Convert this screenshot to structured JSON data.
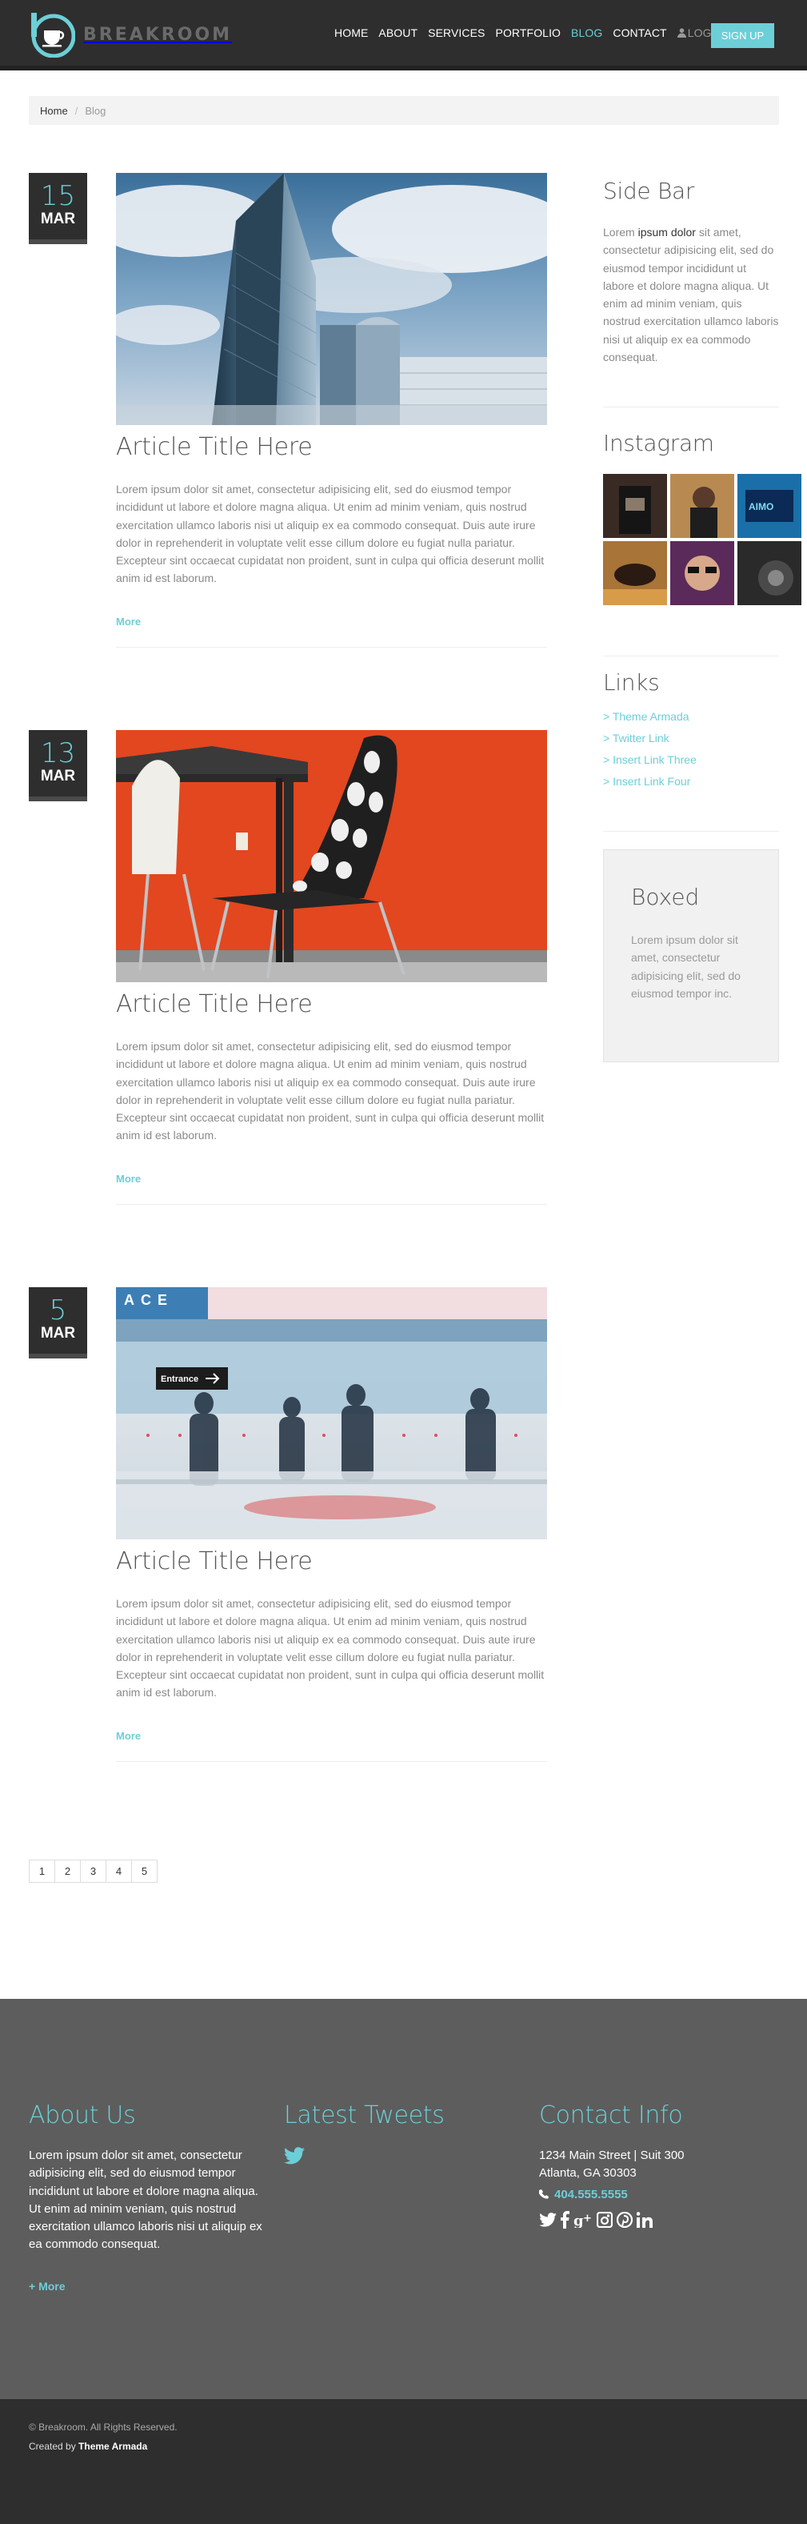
{
  "header": {
    "brand": "BREAKROOM",
    "nav": [
      {
        "label": "HOME",
        "active": false
      },
      {
        "label": "ABOUT",
        "active": false
      },
      {
        "label": "SERVICES",
        "active": false
      },
      {
        "label": "PORTFOLIO",
        "active": false
      },
      {
        "label": "BLOG",
        "active": true
      },
      {
        "label": "CONTACT",
        "active": false
      }
    ],
    "login_label": "LOGIN",
    "signup_label": "SIGN UP",
    "accent_color": "#6ccfd7"
  },
  "breadcrumb": {
    "home": "Home",
    "separator": "/",
    "current": "Blog"
  },
  "posts": [
    {
      "day": "15",
      "month": "MAR",
      "title": "Article Title Here",
      "body": "Lorem ipsum dolor sit amet, consectetur adipisicing elit, sed do eiusmod tempor incididunt ut labore et dolore magna aliqua. Ut enim ad minim veniam, quis nostrud exercitation ullamco laboris nisi ut aliquip ex ea commodo consequat. Duis aute irure dolor in reprehenderit in voluptate velit esse cillum dolore eu fugiat nulla pariatur. Excepteur sint occaecat cupidatat non proident, sunt in culpa qui officia deserunt mollit anim id est laborum.",
      "more": "More"
    },
    {
      "day": "13",
      "month": "MAR",
      "title": "Article Title Here",
      "body": "Lorem ipsum dolor sit amet, consectetur adipisicing elit, sed do eiusmod tempor incididunt ut labore et dolore magna aliqua. Ut enim ad minim veniam, quis nostrud exercitation ullamco laboris nisi ut aliquip ex ea commodo consequat. Duis aute irure dolor in reprehenderit in voluptate velit esse cillum dolore eu fugiat nulla pariatur. Excepteur sint occaecat cupidatat non proident, sunt in culpa qui officia deserunt mollit anim id est laborum.",
      "more": "More"
    },
    {
      "day": "5",
      "month": "MAR",
      "title": "Article Title Here",
      "body": "Lorem ipsum dolor sit amet, consectetur adipisicing elit, sed do eiusmod tempor incididunt ut labore et dolore magna aliqua. Ut enim ad minim veniam, quis nostrud exercitation ullamco laboris nisi ut aliquip ex ea commodo consequat. Duis aute irure dolor in reprehenderit in voluptate velit esse cillum dolore eu fugiat nulla pariatur. Excepteur sint occaecat cupidatat non proident, sunt in culpa qui officia deserunt mollit anim id est laborum.",
      "more": "More",
      "image_sign_top": "ACE",
      "image_sign_entrance": "Entrance"
    }
  ],
  "sidebar": {
    "about_heading": "Side Bar",
    "about_pre": "Lorem",
    "about_bold": "ipsum dolor",
    "about_rest": "sit amet, consectetur adipisicing elit, sed do eiusmod tempor incididunt ut labore et dolore magna aliqua. Ut enim ad minim veniam, quis nostrud exercitation ullamco laboris nisi ut aliquip ex ea commodo consequat.",
    "instagram_heading": "Instagram",
    "links_heading": "Links",
    "links": [
      "> Theme Armada",
      "> Twitter Link",
      "> Insert Link Three",
      "> Insert Link Four"
    ],
    "boxed_heading": "Boxed",
    "boxed_text": "Lorem ipsum dolor sit amet, consectetur adipisicing elit, sed do eiusmod tempor inc."
  },
  "pagination": [
    "1",
    "2",
    "3",
    "4",
    "5"
  ],
  "footer": {
    "about_heading": "About Us",
    "about_text": "Lorem ipsum dolor sit amet, consectetur adipisicing elit, sed do eiusmod tempor incididunt ut labore et dolore magna aliqua. Ut enim ad minim veniam, quis nostrud exercitation ullamco laboris nisi ut aliquip ex ea commodo consequat.",
    "about_more": "+ More",
    "tweets_heading": "Latest Tweets",
    "contact_heading": "Contact Info",
    "address_line1": "1234 Main Street | Suit 300",
    "address_line2": "Atlanta, GA 30303",
    "phone": "404.555.5555",
    "social_icons": [
      "twitter-icon",
      "facebook-icon",
      "google-plus-icon",
      "instagram-icon",
      "pinterest-icon",
      "linkedin-icon"
    ]
  },
  "bottom": {
    "copyright": "© Breakroom. All Rights Reserved.",
    "created_by_prefix": "Created by",
    "created_by_name": "Theme Armada"
  }
}
